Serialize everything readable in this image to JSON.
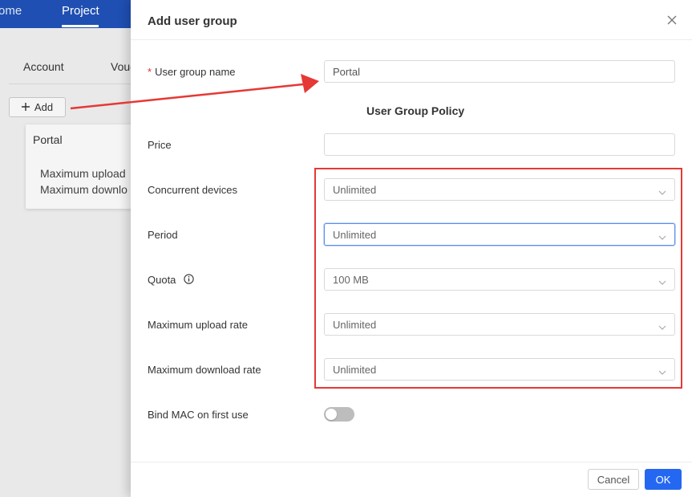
{
  "background": {
    "nav": {
      "home_label": "ome",
      "project_label": "Project"
    },
    "tabs": {
      "account_label": "Account",
      "vou_label": "Vouc"
    },
    "add_button_label": "Add",
    "card": {
      "title": "Portal",
      "line1": "Maximum upload",
      "line2": "Maximum downlo"
    }
  },
  "modal": {
    "title": "Add user group",
    "group_name": {
      "label": "User group name",
      "value": "Portal"
    },
    "section_title": "User Group Policy",
    "price": {
      "label": "Price",
      "value": ""
    },
    "concurrent_devices": {
      "label": "Concurrent devices",
      "value": "Unlimited"
    },
    "period": {
      "label": "Period",
      "value": "Unlimited"
    },
    "quota": {
      "label": "Quota",
      "value": "100 MB"
    },
    "max_upload": {
      "label": "Maximum upload rate",
      "value": "Unlimited"
    },
    "max_download": {
      "label": "Maximum download rate",
      "value": "Unlimited"
    },
    "bind_mac": {
      "label": "Bind MAC on first use",
      "enabled": false
    },
    "cancel_label": "Cancel",
    "ok_label": "OK"
  },
  "colors": {
    "accent": "#2468f2",
    "annotation": "#e53935",
    "topbar": "#1f4fb2"
  }
}
